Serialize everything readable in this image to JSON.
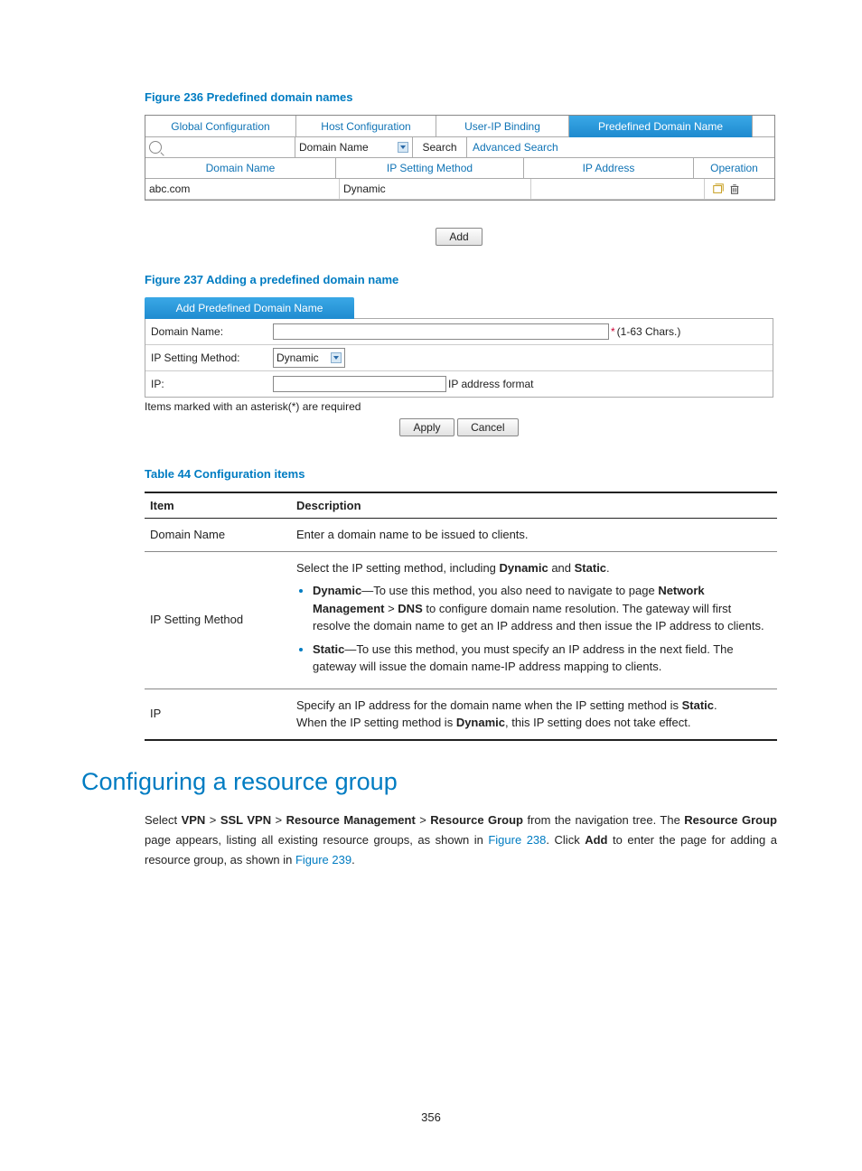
{
  "figure236": {
    "caption": "Figure 236 Predefined domain names",
    "tabs": [
      "Global Configuration",
      "Host Configuration",
      "User-IP Binding",
      "Predefined Domain Name"
    ],
    "search": {
      "filter_field": "Domain Name",
      "search_btn": "Search",
      "advanced": "Advanced Search"
    },
    "headers": [
      "Domain Name",
      "IP Setting Method",
      "IP Address",
      "Operation"
    ],
    "row": {
      "domain": "abc.com",
      "method": "Dynamic",
      "ip": ""
    },
    "add_btn": "Add"
  },
  "figure237": {
    "caption": "Figure 237 Adding a predefined domain name",
    "tab_label": "Add Predefined Domain Name",
    "domain_label": "Domain Name:",
    "domain_hint": "(1-63 Chars.)",
    "method_label": "IP Setting Method:",
    "method_value": "Dynamic",
    "ip_label": "IP:",
    "ip_hint": "IP address format",
    "required_note": "Items marked with an asterisk(*) are required",
    "apply_btn": "Apply",
    "cancel_btn": "Cancel"
  },
  "table44": {
    "caption": "Table 44 Configuration items",
    "headers": {
      "item": "Item",
      "desc": "Description"
    },
    "rows": {
      "domain": {
        "item": "Domain Name",
        "desc": "Enter a domain name to be issued to clients."
      },
      "method": {
        "item": "IP Setting Method",
        "intro_pre": "Select the IP setting method, including ",
        "dyn_word": "Dynamic",
        "and_word": " and ",
        "stat_word": "Static",
        "dyn_bold": "Dynamic",
        "dyn_text": "—To use this method, you also need to navigate to page ",
        "nm_bold": "Network Management",
        "gt": " > ",
        "dns_bold": "DNS",
        "dyn_tail": " to configure domain name resolution. The gateway will first resolve the domain name to get an IP address and then issue the IP address to clients.",
        "stat_bold": "Static",
        "stat_text": "—To use this method, you must specify an IP address in the next field. The gateway will issue the domain name-IP address mapping to clients."
      },
      "ip": {
        "item": "IP",
        "line1_pre": "Specify an IP address for the domain name when the IP setting method is ",
        "static_b": "Static",
        "line2_pre": "When the IP setting method is ",
        "dynamic_b": "Dynamic",
        "line2_post": ", this IP setting does not take effect."
      }
    }
  },
  "section": {
    "heading": "Configuring a resource group",
    "p_pre": "Select ",
    "vpn": "VPN",
    "ssl": "SSL VPN",
    "rm": "Resource Management",
    "rg": "Resource Group",
    "p_mid1": " from the navigation tree. The ",
    "rg2": "Resource Group",
    "p_mid2": " page appears, listing all existing resource groups, as shown in ",
    "fig238": "Figure 238",
    "p_mid3": ". Click ",
    "add_b": "Add",
    "p_mid4": " to enter the page for adding a resource group, as shown in ",
    "fig239": "Figure 239",
    "p_end": "."
  },
  "page_number": "356"
}
